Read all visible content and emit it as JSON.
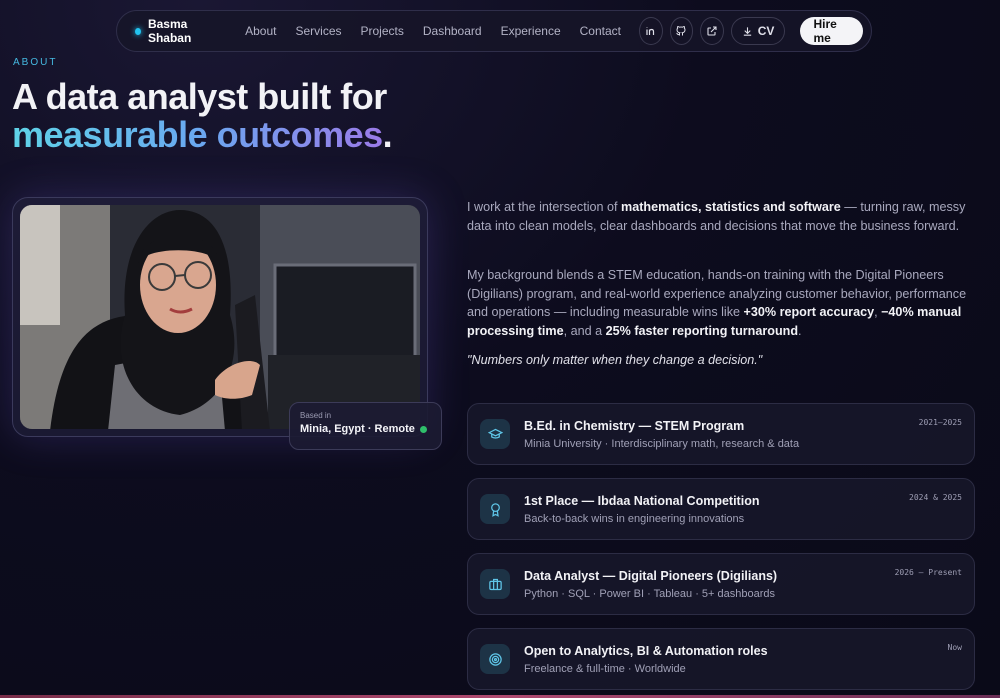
{
  "nav": {
    "brand": "Basma Shaban",
    "links": [
      "About",
      "Services",
      "Projects",
      "Dashboard",
      "Experience",
      "Contact"
    ],
    "icons": [
      "linkedin-icon",
      "github-icon",
      "external-link-icon"
    ],
    "cv_label": "CV",
    "hire_label": "Hire me"
  },
  "hero": {
    "eyebrow": "ABOUT",
    "title_line1": "A data analyst built for",
    "title_highlight": "measurable outcomes",
    "title_period": "."
  },
  "photo": {
    "based_in_label": "Based in",
    "based_in_value": "Minia, Egypt · Remote"
  },
  "about": {
    "p1_a": "I work at the intersection of ",
    "p1_b": "mathematics, statistics and software",
    "p1_c": " — turning raw, messy data into clean models, clear dashboards and decisions that move the business forward.",
    "p2_a": "My background blends a STEM education, hands-on training with the Digital Pioneers (Digilians) program, and real-world experience analyzing customer behavior, performance and operations — including measurable wins like ",
    "p2_b": "+30% report accuracy",
    "p2_c": ", ",
    "p2_d": "−40% manual processing time",
    "p2_e": ", and a ",
    "p2_f": "25% faster reporting turnaround",
    "p2_g": ".",
    "quote": "\"Numbers only matter when they change a decision.\""
  },
  "cards": [
    {
      "title": "B.Ed. in Chemistry — STEM Program",
      "sub": "Minia University · Interdisciplinary math, research & data",
      "date": "2021–2025",
      "icon": "graduation-cap-icon"
    },
    {
      "title": "1st Place — Ibdaa National Competition",
      "sub": "Back-to-back wins in engineering innovations",
      "date": "2024 & 2025",
      "icon": "award-icon"
    },
    {
      "title": "Data Analyst — Digital Pioneers (Digilians)",
      "sub": "Python · SQL · Power BI · Tableau · 5+ dashboards",
      "date": "2026 – Present",
      "icon": "briefcase-icon"
    },
    {
      "title": "Open to Analytics, BI & Automation roles",
      "sub": "Freelance & full-time · Worldwide",
      "date": "Now",
      "icon": "target-icon"
    }
  ],
  "colors": {
    "accent": "#22c4f0",
    "background": "#0d0c1e",
    "gradient_start": "#5fd3e8",
    "gradient_end": "#9a7ae8"
  }
}
